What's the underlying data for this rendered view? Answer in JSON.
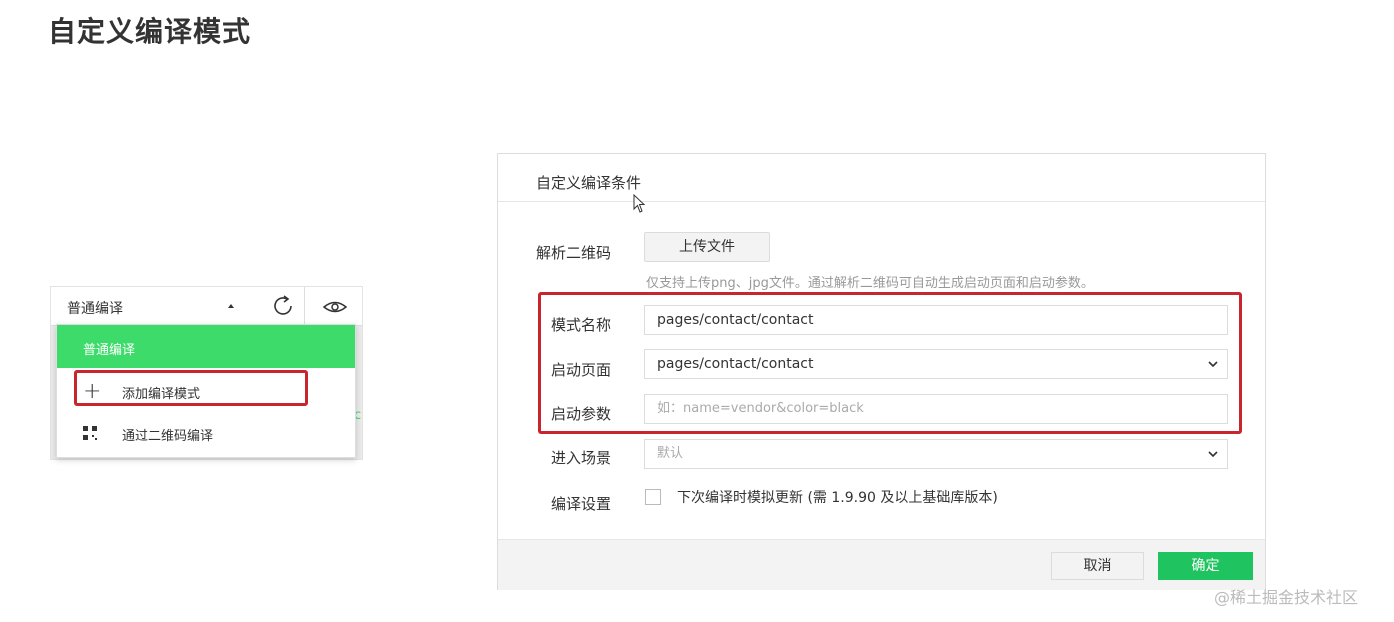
{
  "page": {
    "title": "自定义编译模式"
  },
  "toolbar": {
    "compile_mode": "普通编译",
    "dropdown_items": {
      "selected": "普通编译",
      "add_mode": "添加编译模式",
      "qr_compile": "通过二维码编译"
    }
  },
  "dialog": {
    "title": "自定义编译条件",
    "qr": {
      "label": "解析二维码",
      "upload_label": "上传文件",
      "help": "仅支持上传png、jpg文件。通过解析二维码可自动生成启动页面和启动参数。"
    },
    "mode_name": {
      "label": "模式名称",
      "value": "pages/contact/contact"
    },
    "start_page": {
      "label": "启动页面",
      "value": "pages/contact/contact"
    },
    "start_params": {
      "label": "启动参数",
      "placeholder": "如：name=vendor&color=black"
    },
    "scene": {
      "label": "进入场景",
      "value": "默认"
    },
    "compile_settings": {
      "label": "编译设置",
      "checkbox_label": "下次编译时模拟更新 (需 1.9.90 及以上基础库版本)",
      "checked": false
    },
    "cancel_label": "取消",
    "confirm_label": "确定"
  },
  "colors": {
    "accent_green": "#3ddc6a",
    "highlight_red": "#c8262c"
  },
  "watermark": "@稀土掘金技术社区"
}
